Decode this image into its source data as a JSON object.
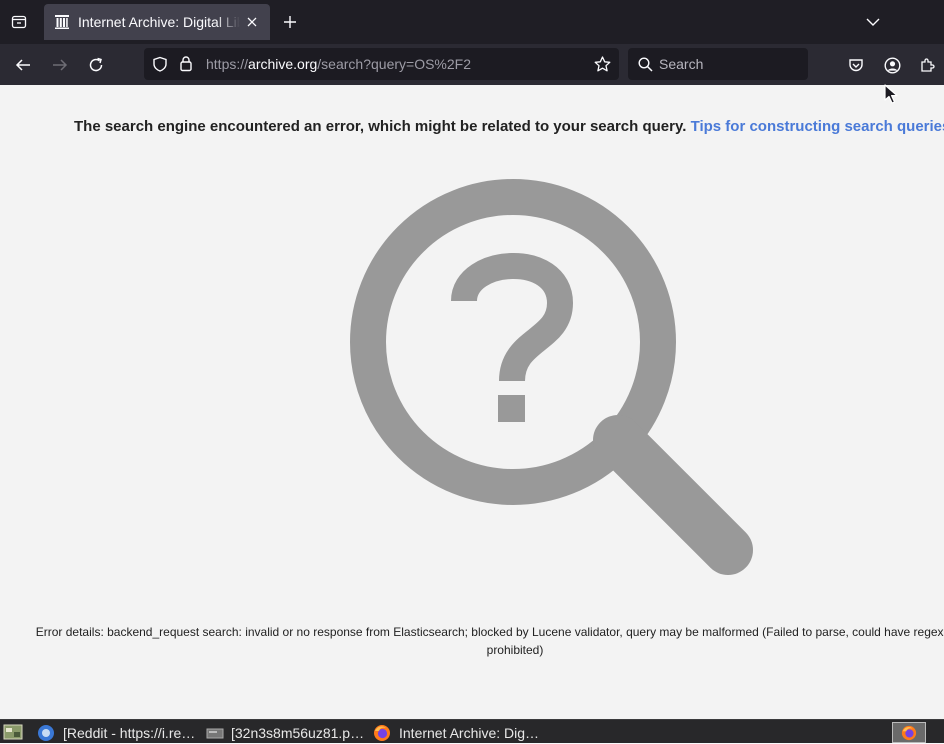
{
  "browser": {
    "tab": {
      "title": "Internet Archive: Digital Library of Free & Borrowable Books"
    },
    "url": {
      "prefix": "https://",
      "host": "archive.org",
      "path": "/search?query=OS%2F2"
    },
    "search": {
      "placeholder": "Search"
    }
  },
  "page": {
    "error_message": "The search engine encountered an error, which might be related to your search query.",
    "tips_link": "Tips for constructing search queries",
    "error_details_line1": "Error details: backend_request search: invalid or no response from Elasticsearch; blocked by Lucene validator, query may be malformed (Failed to parse, could have regex, wildcard",
    "error_details_line2": "prohibited)"
  },
  "taskbar": {
    "items": [
      {
        "label": "[Reddit - https://i.re…"
      },
      {
        "label": "[32n3s8m56uz81.p…"
      },
      {
        "label": "Internet Archive: Dig…"
      }
    ]
  },
  "colors": {
    "accent_link": "#4a7ad8",
    "icon_gray": "#999999",
    "chrome_dark": "#2b2a33"
  },
  "icons": [
    "tab-list-icon",
    "archive-favicon-icon",
    "close-icon",
    "plus-icon",
    "chevron-down-icon",
    "back-icon",
    "forward-icon",
    "reload-icon",
    "shield-icon",
    "lock-icon",
    "star-icon",
    "search-icon",
    "pocket-icon",
    "account-icon",
    "extensions-icon",
    "magnifier-question-icon",
    "firefox-icon"
  ]
}
